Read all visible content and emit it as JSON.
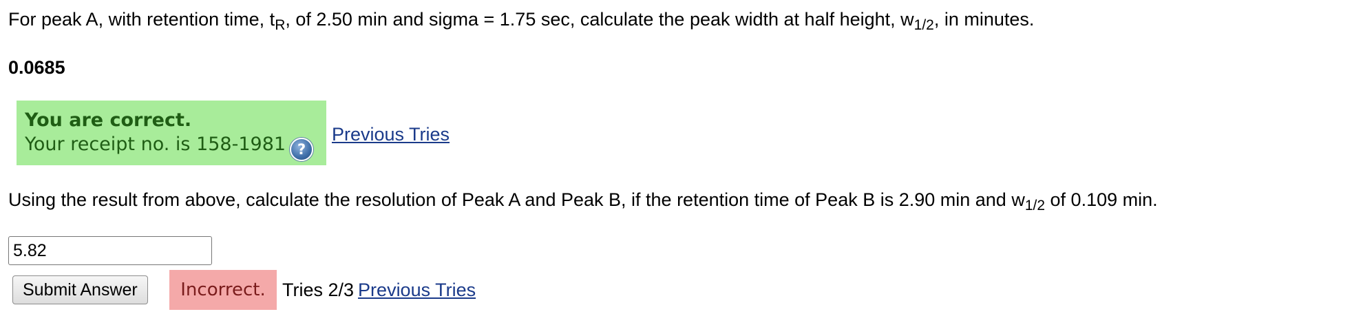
{
  "question1": {
    "part1": "For peak A, with retention time, t",
    "sub1": "R",
    "part2": ", of 2.50 min and sigma = 1.75 sec, calculate the peak width at half height, w",
    "sub2": "1/2",
    "part3": ", in minutes."
  },
  "answer1": {
    "value": "0.0685"
  },
  "feedback1": {
    "title": "You are correct.",
    "receipt_text": "Your receipt no. is 158-1981",
    "help_glyph": "?",
    "help_icon": "question-circle-icon",
    "previous_tries_label": "Previous Tries",
    "bg_color": "#a8ec9a"
  },
  "question2": {
    "part1": "Using the result from above, calculate the resolution of Peak A and Peak B, if the retention time of Peak B is 2.90 min and w",
    "sub1": "1/2",
    "part2": " of 0.109 min."
  },
  "answer2": {
    "input_value": "5.82",
    "submit_label": "Submit Answer",
    "status_label": "Incorrect.",
    "status_bg_color": "#f4a9a9",
    "tries_text": "Tries 2/3",
    "previous_tries_label": "Previous Tries"
  }
}
